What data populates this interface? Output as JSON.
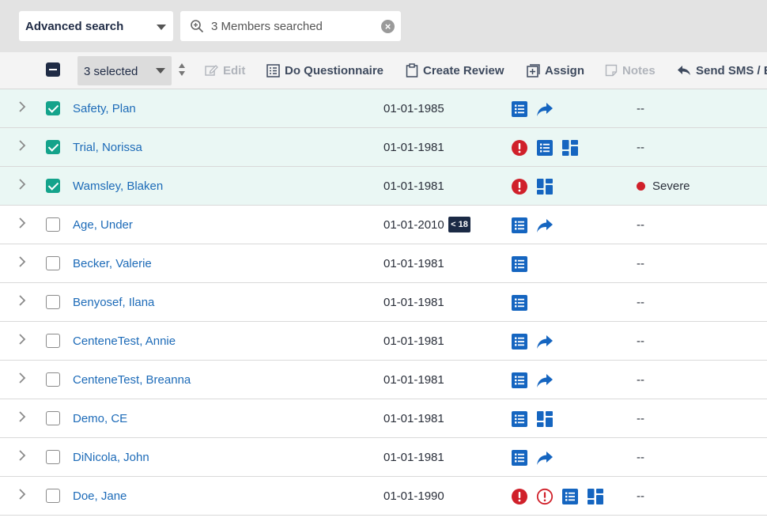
{
  "search": {
    "mode_label": "Advanced search",
    "query_value": "3 Members searched"
  },
  "toolbar": {
    "selected_label": "3 selected",
    "edit_label": "Edit",
    "questionnaire_label": "Do Questionnaire",
    "review_label": "Create Review",
    "assign_label": "Assign",
    "notes_label": "Notes",
    "sms_label": "Send SMS / E"
  },
  "colors": {
    "selected_row_bg": "#eaf7f4",
    "checkbox_checked": "#14a38b",
    "link_blue": "#1d6bb8",
    "icon_blue": "#1565c0",
    "alert_red": "#d0202a"
  },
  "members": [
    {
      "name": "Safety, Plan",
      "dob": "01-01-1985",
      "selected": true,
      "age_badge": "",
      "icons": [
        "list-icon",
        "forward-arrow-icon"
      ],
      "status": "--",
      "severity_dot": false
    },
    {
      "name": "Trial, Norissa",
      "dob": "01-01-1981",
      "selected": true,
      "age_badge": "",
      "icons": [
        "alert-filled-icon",
        "list-icon",
        "dashboard-icon"
      ],
      "status": "--",
      "severity_dot": false
    },
    {
      "name": "Wamsley, Blaken",
      "dob": "01-01-1981",
      "selected": true,
      "age_badge": "",
      "icons": [
        "alert-filled-icon",
        "dashboard-icon"
      ],
      "status": "Severe",
      "severity_dot": true
    },
    {
      "name": "Age, Under",
      "dob": "01-01-2010",
      "selected": false,
      "age_badge": "< 18",
      "icons": [
        "list-icon",
        "forward-arrow-icon"
      ],
      "status": "--",
      "severity_dot": false
    },
    {
      "name": "Becker, Valerie",
      "dob": "01-01-1981",
      "selected": false,
      "age_badge": "",
      "icons": [
        "list-icon"
      ],
      "status": "--",
      "severity_dot": false
    },
    {
      "name": "Benyosef, Ilana",
      "dob": "01-01-1981",
      "selected": false,
      "age_badge": "",
      "icons": [
        "list-icon"
      ],
      "status": "--",
      "severity_dot": false
    },
    {
      "name": "CenteneTest, Annie",
      "dob": "01-01-1981",
      "selected": false,
      "age_badge": "",
      "icons": [
        "list-icon",
        "forward-arrow-icon"
      ],
      "status": "--",
      "severity_dot": false
    },
    {
      "name": "CenteneTest, Breanna",
      "dob": "01-01-1981",
      "selected": false,
      "age_badge": "",
      "icons": [
        "list-icon",
        "forward-arrow-icon"
      ],
      "status": "--",
      "severity_dot": false
    },
    {
      "name": "Demo, CE",
      "dob": "01-01-1981",
      "selected": false,
      "age_badge": "",
      "icons": [
        "list-icon",
        "dashboard-icon"
      ],
      "status": "--",
      "severity_dot": false
    },
    {
      "name": "DiNicola, John",
      "dob": "01-01-1981",
      "selected": false,
      "age_badge": "",
      "icons": [
        "list-icon",
        "forward-arrow-icon"
      ],
      "status": "--",
      "severity_dot": false
    },
    {
      "name": "Doe, Jane",
      "dob": "01-01-1990",
      "selected": false,
      "age_badge": "",
      "icons": [
        "alert-filled-icon",
        "alert-outline-icon",
        "list-icon",
        "dashboard-icon"
      ],
      "status": "--",
      "severity_dot": false
    }
  ]
}
